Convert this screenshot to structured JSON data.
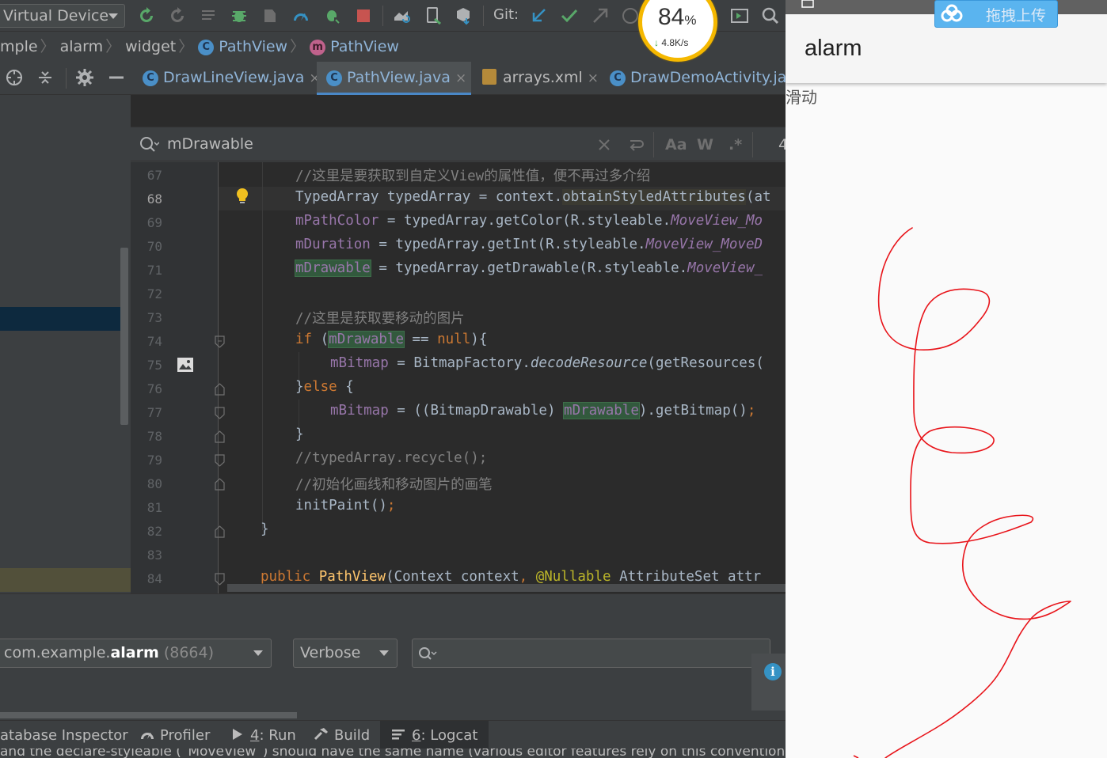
{
  "ide": {
    "toolbar": {
      "device": "Virtual Device",
      "git_label": "Git:"
    },
    "speed_widget": {
      "percent": "84",
      "percent_sign": "%",
      "arrow": "↓",
      "rate": "4.8K/s"
    },
    "breadcrumb": {
      "items": [
        "mple",
        "alarm",
        "widget",
        "PathView",
        "PathView"
      ],
      "class_icon": "C",
      "method_icon": "m"
    },
    "tabs": [
      {
        "label": "DrawLineView.java",
        "close": "×"
      },
      {
        "label": "PathView.java",
        "close": "×"
      },
      {
        "label": "arrays.xml",
        "close": "×"
      },
      {
        "label": "DrawDemoActivity.java",
        "close": ""
      }
    ],
    "search": {
      "term": "mDrawable",
      "match_case": "Aa",
      "words": "W",
      "regex": ".*",
      "count": "4"
    },
    "editor": {
      "line_numbers": [
        "67",
        "68",
        "69",
        "70",
        "71",
        "72",
        "73",
        "74",
        "75",
        "76",
        "77",
        "78",
        "79",
        "80",
        "81",
        "82",
        "83",
        "84"
      ],
      "current_line": "68",
      "lines": {
        "l67": "//这里是要获取到自定义View的属性值，便不再过多介绍",
        "l68_a": "TypedArray typedArray = context.",
        "l68_b": "obtainStyledAttributes",
        "l68_c": "(at",
        "l69_a": "mPathColor",
        "l69_b": " = typedArray.getColor(R.styleable.",
        "l69_c": "MoveView_Mo",
        "l70_a": "mDuration",
        "l70_b": " = typedArray.getInt(R.styleable.",
        "l70_c": "MoveView_MoveD",
        "l71_a": "mDrawable",
        "l71_b": " = typedArray.getDrawable(R.styleable.",
        "l71_c": "MoveView_",
        "l73": "//这里是获取要移动的图片",
        "l74_a": "if",
        "l74_b": " (",
        "l74_c": "mDrawable",
        "l74_d": " == ",
        "l74_e": "null",
        "l74_f": "){",
        "l75_a": "mBitmap",
        "l75_b": " = BitmapFactory.",
        "l75_c": "decodeResource",
        "l75_d": "(getResources(",
        "l76_a": "}",
        "l76_b": "else",
        "l76_c": " {",
        "l77_a": "mBitmap",
        "l77_b": " = ((BitmapDrawable) ",
        "l77_c": "mDrawable",
        "l77_d": ").getBitmap()",
        "l77_e": ";",
        "l78": "}",
        "l79": "//typedArray.recycle();",
        "l80": "//初始化画线和移动图片的画笔",
        "l81_a": "initPaint()",
        "l81_b": ";",
        "l82": "}",
        "l84_a": "public ",
        "l84_b": "PathView",
        "l84_c": "(Context context",
        "l84_d": ", ",
        "l84_e": "@Nullable",
        "l84_f": " AttributeSet attr"
      }
    },
    "logcat": {
      "process_prefix": "com.example.",
      "process_bold": "alarm",
      "process_pid": "(8664)",
      "level": "Verbose",
      "search_placeholder": ""
    },
    "statusbar": [
      {
        "label": "atabase Inspector"
      },
      {
        "label": "Profiler"
      },
      {
        "num": "4",
        "label": ": Run"
      },
      {
        "label": "Build"
      },
      {
        "num": "6",
        "label": ": Logcat"
      }
    ],
    "message": "and the declare-styleable (`MoveView`) should have the same name (various editor features rely on this convention)"
  },
  "emulator": {
    "app_title": "alarm",
    "content_text": "滑动",
    "upload_button": "拖拽上传",
    "stroke_color": "#e8141a"
  }
}
